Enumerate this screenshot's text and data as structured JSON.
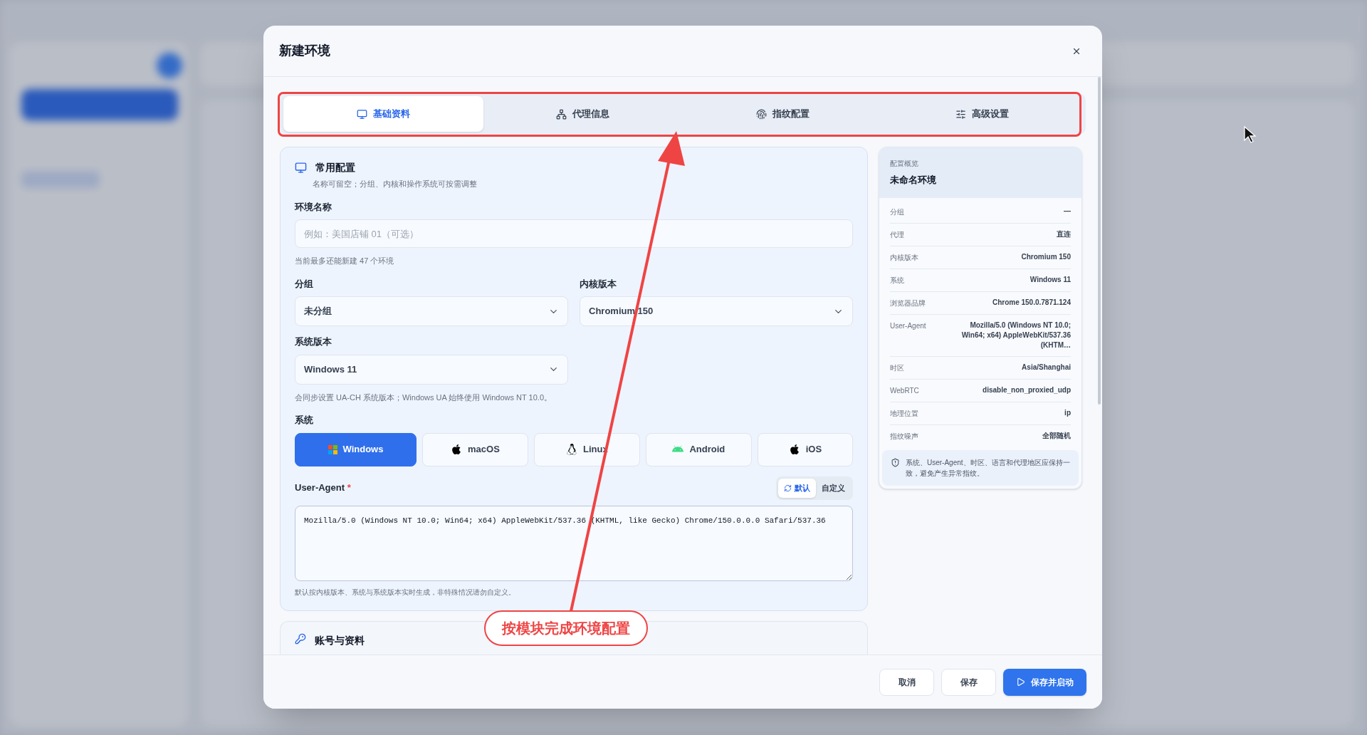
{
  "modal": {
    "title": "新建环境"
  },
  "tabs": [
    {
      "label": "基础资料",
      "selected": true
    },
    {
      "label": "代理信息",
      "selected": false
    },
    {
      "label": "指纹配置",
      "selected": false
    },
    {
      "label": "高级设置",
      "selected": false
    }
  ],
  "section": {
    "title": "常用配置",
    "subtitle": "名称可留空；分组、内核和操作系统可按需调整"
  },
  "name_field": {
    "label": "环境名称",
    "placeholder": "例如：美国店铺 01（可选）",
    "hint": "当前最多还能新建 47 个环境"
  },
  "group_select": {
    "label": "分组",
    "value": "未分组"
  },
  "kernel_select": {
    "label": "内核版本",
    "value": "Chromium 150"
  },
  "os_version_select": {
    "label": "系统版本",
    "value": "Windows 11",
    "hint": "会同步设置 UA-CH 系统版本；Windows UA 始终使用 Windows NT 10.0。"
  },
  "system": {
    "label": "系统",
    "options": [
      {
        "label": "Windows",
        "selected": true
      },
      {
        "label": "macOS",
        "selected": false
      },
      {
        "label": "Linux",
        "selected": false
      },
      {
        "label": "Android",
        "selected": false
      },
      {
        "label": "iOS",
        "selected": false
      }
    ]
  },
  "user_agent": {
    "label": "User-Agent",
    "required": "*",
    "modes": [
      {
        "label": "默认",
        "selected": true
      },
      {
        "label": "自定义",
        "selected": false
      }
    ],
    "value": "Mozilla/5.0 (Windows NT 10.0; Win64; x64) AppleWebKit/537.36 (KHTML, like Gecko) Chrome/150.0.0.0 Safari/537.36",
    "hint": "默认按内核版本、系统与系统版本实时生成，非特殊情况请勿自定义。"
  },
  "section_2": {
    "title": "账号与资料"
  },
  "summary": {
    "caption": "配置概览",
    "title": "未命名环境",
    "rows": [
      {
        "label": "分组",
        "value": "—"
      },
      {
        "label": "代理",
        "value": "直连"
      },
      {
        "label": "内核版本",
        "value": "Chromium 150"
      },
      {
        "label": "系统",
        "value": "Windows 11"
      },
      {
        "label": "浏览器品牌",
        "value": "Chrome 150.0.7871.124"
      },
      {
        "label": "User-Agent",
        "value": "Mozilla/5.0 (Windows NT 10.0; Win64; x64) AppleWebKit/537.36 (KHTM…"
      },
      {
        "label": "时区",
        "value": "Asia/Shanghai"
      },
      {
        "label": "WebRTC",
        "value": "disable_non_proxied_udp"
      },
      {
        "label": "地理位置",
        "value": "ip"
      },
      {
        "label": "指纹噪声",
        "value": "全部随机"
      }
    ],
    "note": "系统、User-Agent、时区、语言和代理地区应保持一致，避免产生异常指纹。"
  },
  "footer": {
    "buttons": [
      {
        "label": "取消",
        "kind": "secondary"
      },
      {
        "label": "保存",
        "kind": "secondary"
      },
      {
        "label": "保存并启动",
        "kind": "primary"
      }
    ]
  },
  "annotation": {
    "callout": "按模块完成环境配置"
  }
}
